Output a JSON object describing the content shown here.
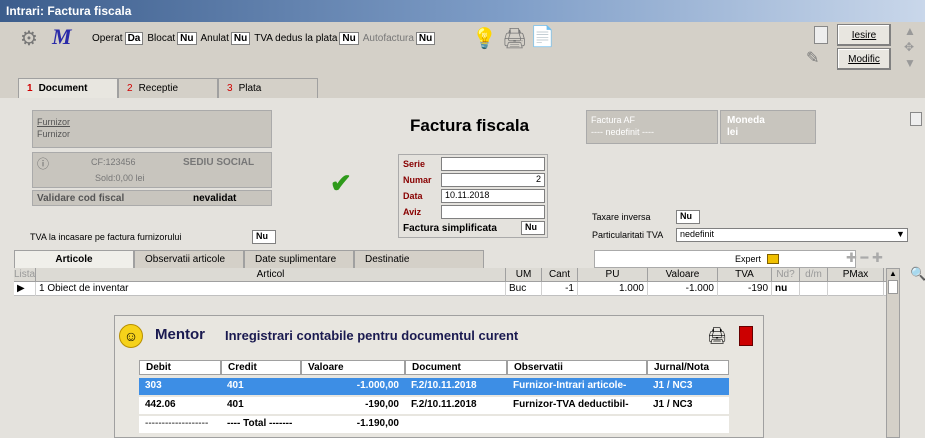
{
  "window": {
    "title": "Intrari: Factura fiscala"
  },
  "toolbar": {
    "operat_label": "Operat",
    "operat_value": "Da",
    "blocat_label": "Blocat",
    "blocat_value": "Nu",
    "anulat_label": "Anulat",
    "anulat_value": "Nu",
    "tva_dedus_label": "TVA dedus la plata",
    "tva_dedus_value": "Nu",
    "autofactura_label": "Autofactura",
    "autofactura_value": "Nu",
    "iesire_label": "Iesire",
    "modific_label": "Modific"
  },
  "tabs": [
    {
      "num": "1",
      "label": "Document"
    },
    {
      "num": "2",
      "label": "Receptie"
    },
    {
      "num": "3",
      "label": "Plata"
    }
  ],
  "furnizor": {
    "label1": "Furnizor",
    "label2": "Furnizor",
    "cf": "CF:123456",
    "sediu": "SEDIU SOCIAL",
    "sold": "Sold:0,00 lei",
    "validare_label": "Validare cod fiscal",
    "validare_value": "nevalidat"
  },
  "document": {
    "title": "Factura fiscala",
    "serie_label": "Serie",
    "serie_value": "",
    "numar_label": "Numar",
    "numar_value": "2",
    "data_label": "Data",
    "data_value": "10.11.2018",
    "aviz_label": "Aviz",
    "aviz_value": "",
    "simplificata_label": "Factura simplificata",
    "simplificata_value": "Nu"
  },
  "factura_af": {
    "label": "Factura AF",
    "value": "---- nedefinit ----"
  },
  "moneda": {
    "label": "Moneda",
    "value": "lei"
  },
  "taxare_inversa": {
    "label": "Taxare inversa",
    "value": "Nu"
  },
  "particularitati": {
    "label": "Particularitati TVA",
    "value": "nedefinit"
  },
  "tva_incasare": {
    "label": "TVA la incasare pe factura furnizorului",
    "value": "Nu"
  },
  "subtabs": [
    "Articole",
    "Observatii articole",
    "Date suplimentare",
    "Destinatie"
  ],
  "expert_label": "Expert",
  "grid": {
    "headers": [
      "Lista",
      "Articol",
      "UM",
      "Cant",
      "PU",
      "Valoare",
      "TVA",
      "Nd?",
      "d/m",
      "PMax"
    ],
    "rows": [
      {
        "idx": "1",
        "articol": "Obiect de inventar",
        "um": "Buc",
        "cant": "-1",
        "pu": "1.000",
        "valoare": "-1.000",
        "tva": "-190",
        "nd": "nu",
        "dm": "",
        "pmax": ""
      }
    ]
  },
  "mentor": {
    "title": "Mentor",
    "subtitle": "Inregistrari contabile pentru documentul curent",
    "headers": [
      "Debit",
      "Credit",
      "Valoare",
      "Document",
      "Observatii",
      "Jurnal/Nota"
    ],
    "rows": [
      {
        "debit": "303",
        "credit": "401",
        "valoare": "-1.000,00",
        "document": "F.2/10.11.2018",
        "observatii": "Furnizor-Intrari articole-",
        "jurnal": "J1 / NC3"
      },
      {
        "debit": "442.06",
        "credit": "401",
        "valoare": "-190,00",
        "document": "F.2/10.11.2018",
        "observatii": "Furnizor-TVA deductibil-",
        "jurnal": "J1 / NC3"
      }
    ],
    "total_debit": "-------------------",
    "total_label": "---- Total -------",
    "total_value": "-1.190,00"
  },
  "colors": {
    "accent": "#3d8ee5",
    "red": "#d00000",
    "check": "#2e9a1a"
  }
}
